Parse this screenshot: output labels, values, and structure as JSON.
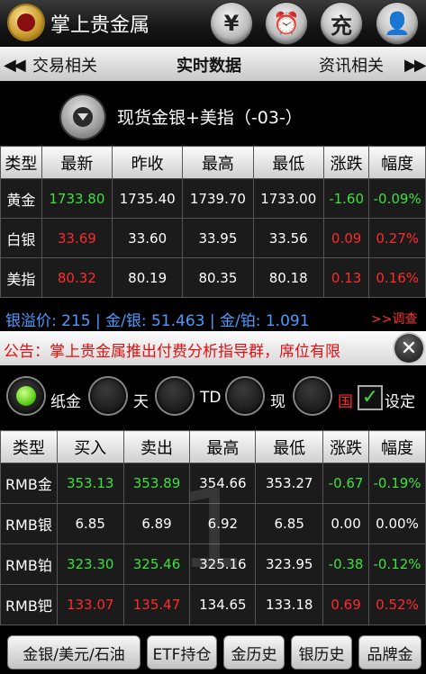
{
  "app": {
    "title": "掌上贵金属"
  },
  "toolbar": {
    "btn1": "¥",
    "btn2": "⏰",
    "btn3": "充",
    "btn4": "👤"
  },
  "tabs": {
    "left": "交易相关",
    "center": "实时数据",
    "right": "资讯相关"
  },
  "selector": {
    "label": "现货金银+美指（-03-）"
  },
  "table1": {
    "headers": [
      "类型",
      "最新",
      "昨收",
      "最高",
      "最低",
      "涨跌",
      "幅度"
    ],
    "rows": [
      {
        "type": "黄金",
        "latest": "1733.80",
        "prev": "1735.40",
        "high": "1739.70",
        "low": "1733.00",
        "change": "-1.60",
        "pct": "-0.09%"
      },
      {
        "type": "白银",
        "latest": "33.69",
        "prev": "33.60",
        "high": "33.95",
        "low": "33.56",
        "change": "0.09",
        "pct": "0.27%"
      },
      {
        "type": "美指",
        "latest": "80.32",
        "prev": "80.19",
        "high": "80.35",
        "low": "80.18",
        "change": "0.13",
        "pct": "0.16%"
      }
    ]
  },
  "spread": {
    "text": "银溢价: 215 | 金/银: 51.463 | 金/铂: 1.091",
    "link": ">>调查"
  },
  "notice": {
    "text": "公告：掌上贵金属推出付费分析指导群，席位有限"
  },
  "radios": {
    "opt1": "纸金",
    "opt2": "天",
    "opt3": "TD",
    "opt4": "现",
    "opt5": "国",
    "settings": "设定"
  },
  "table2": {
    "headers": [
      "类型",
      "买入",
      "卖出",
      "最高",
      "最低",
      "涨跌",
      "幅度"
    ],
    "rows": [
      {
        "type": "RMB金",
        "buy": "353.13",
        "sell": "353.89",
        "high": "354.66",
        "low": "353.27",
        "change": "-0.67",
        "pct": "-0.19%"
      },
      {
        "type": "RMB银",
        "buy": "6.85",
        "sell": "6.89",
        "high": "6.92",
        "low": "6.85",
        "change": "0.00",
        "pct": "0.00%"
      },
      {
        "type": "RMB铂",
        "buy": "323.30",
        "sell": "325.46",
        "high": "325.16",
        "low": "323.95",
        "change": "-0.38",
        "pct": "-0.12%"
      },
      {
        "type": "RMB钯",
        "buy": "133.07",
        "sell": "135.47",
        "high": "134.65",
        "low": "133.18",
        "change": "0.69",
        "pct": "0.52%"
      }
    ]
  },
  "watermark": "1",
  "bottom": {
    "b1": "金银/美元/石油",
    "b2": "ETF持仓",
    "b3": "金历史",
    "b4": "银历史",
    "b5": "品牌金"
  }
}
